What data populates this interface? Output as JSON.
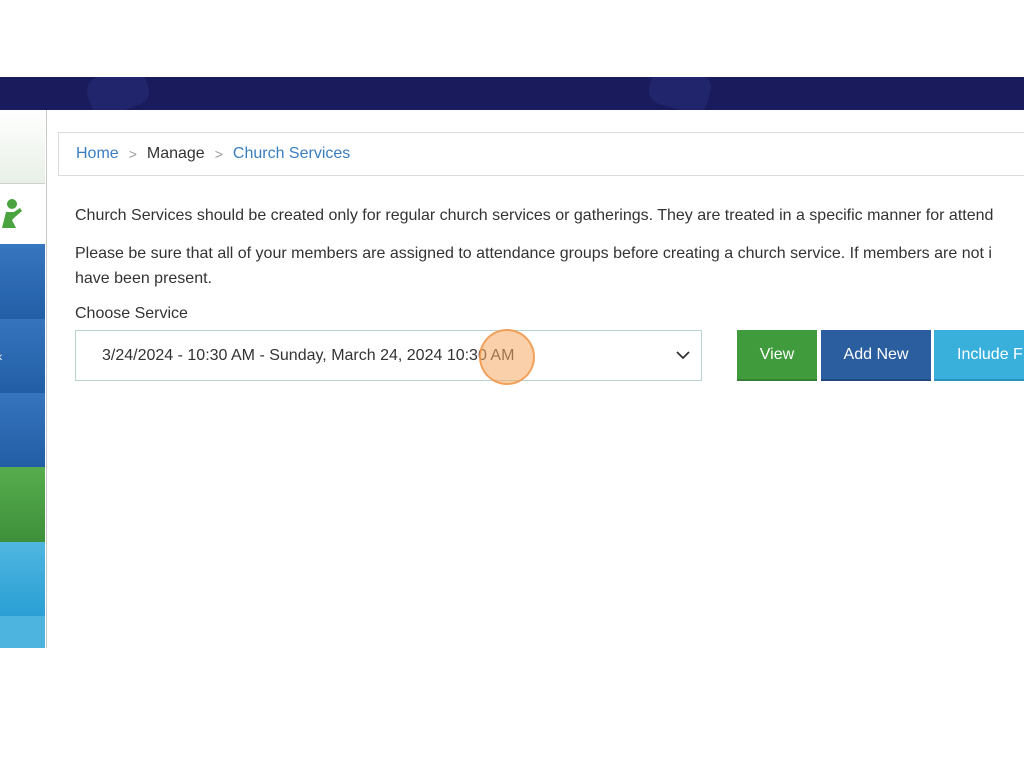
{
  "breadcrumb": {
    "home": "Home",
    "separator1": ">",
    "manage": "Manage",
    "separator2": ">",
    "church_services": "Church Services"
  },
  "content": {
    "paragraph1": "Church Services should be created only for regular church services or gatherings. They are treated in a specific manner for attend",
    "paragraph2_line1": "Please be sure that all of your members are assigned to attendance groups before creating a church service. If members are not i",
    "paragraph2_line2": "have been present.",
    "choose_service_label": "Choose Service",
    "selected_service": "3/24/2024 - 10:30 AM - Sunday, March 24, 2024 10:30 AM"
  },
  "buttons": {
    "view": "View",
    "add_new": "Add New",
    "include": "Include F"
  },
  "sidebar": {
    "chevron": "‹"
  },
  "colors": {
    "header_band": "#191b5c",
    "view_button": "#3f9b3c",
    "add_new_button": "#2b5e9e",
    "include_button": "#39b0dc",
    "link": "#3b7ec0"
  }
}
